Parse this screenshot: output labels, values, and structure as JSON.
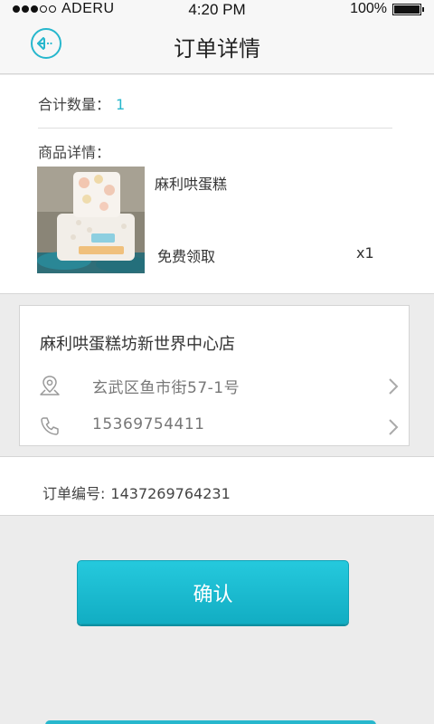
{
  "status_bar": {
    "carrier": "ADERU",
    "time": "4:20 PM",
    "battery": "100%",
    "signal_dots_filled": 3,
    "signal_dots_total": 5
  },
  "nav": {
    "title": "订单详情",
    "back_icon": "back-arrow-circle-icon"
  },
  "order_summary": {
    "qty_label": "合计数量：",
    "qty_value": "1",
    "detail_label": "商品详情："
  },
  "product": {
    "name": "麻利哄蛋糕",
    "price_text": "免费领取",
    "count": "x1",
    "image_icon": "cake-photo"
  },
  "store": {
    "name": "麻利哄蛋糕坊新世界中心店",
    "address": "玄武区鱼市街57-1号",
    "phone": "15369754411"
  },
  "order": {
    "label": "订单编号:",
    "number": "1437269764231"
  },
  "actions": {
    "confirm_label": "确认"
  },
  "colors": {
    "accent": "#27b7cd",
    "button": "#1cbcd0",
    "background": "#ececec"
  }
}
